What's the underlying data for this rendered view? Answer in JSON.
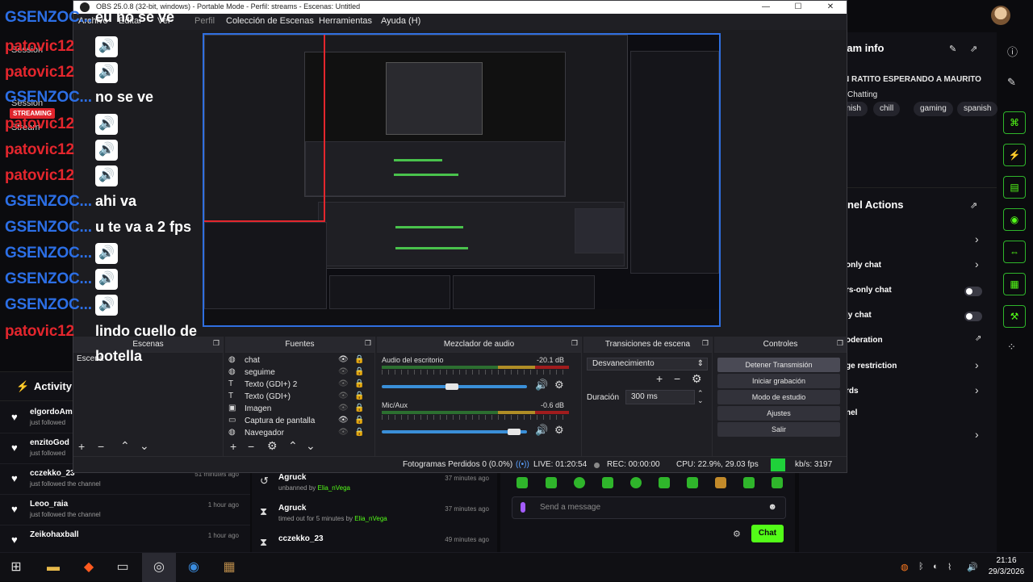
{
  "kick": {
    "left_nav": [
      {
        "label": "Session"
      },
      {
        "label": "Session"
      },
      {
        "label": "Stream"
      }
    ],
    "live_badge": "STREAMING",
    "logo": "KICK",
    "activity": {
      "title": "Activity",
      "items": [
        {
          "user": "elgordoAm",
          "sub": "just followed",
          "time": ""
        },
        {
          "user": "enzitoGod",
          "sub": "just followed",
          "time": ""
        },
        {
          "user": "cczekko_23",
          "sub": "just followed the channel",
          "time": "51 minutes ago"
        },
        {
          "user": "Leoo_raia",
          "sub": "just followed the channel",
          "time": "1 hour ago"
        },
        {
          "user": "Zeikohaxball",
          "sub": "",
          "time": "1 hour ago"
        }
      ]
    },
    "mod_log": [
      {
        "user": "Agruck",
        "sub_prefix": "unbanned by ",
        "actor": "Elia_nVega",
        "time": "37 minutes ago",
        "icon": "unban-icon"
      },
      {
        "user": "Agruck",
        "sub_prefix": "timed out for 5 minutes by ",
        "actor": "Elia_nVega",
        "time": "37 minutes ago",
        "icon": "hourglass-icon"
      },
      {
        "user": "cczekko_23",
        "sub_prefix": "",
        "actor": "",
        "time": "49 minutes ago",
        "icon": "hourglass-icon"
      }
    ],
    "chat": {
      "placeholder": "Send a message",
      "send_label": "Chat"
    },
    "stream_info": {
      "title": "eam info",
      "stream_title": "N RATITO ESPERANDO A MAURITO",
      "category": "Chatting",
      "tags": [
        "anish",
        "chill",
        "gaming",
        "spanish"
      ]
    },
    "channel_actions": {
      "title": "nnel Actions",
      "rows": [
        {
          "label": "",
          "control": "chevron"
        },
        {
          "label": "only chat",
          "control": "chevron"
        },
        {
          "label": "rs-only chat",
          "control": "toggle"
        },
        {
          "label": "ly chat",
          "control": "toggle"
        },
        {
          "label": "oderation",
          "control": "external"
        },
        {
          "label": "ge restriction",
          "control": "chevron"
        },
        {
          "label": "rds",
          "control": "chevron"
        },
        {
          "label": "nel",
          "control": ""
        },
        {
          "label": "",
          "control": "chevron"
        }
      ]
    }
  },
  "overlay_chat": [
    {
      "name": "GSENZOC...",
      "color": "blue",
      "msg": "eu no se ve",
      "speaker": false
    },
    {
      "name": "patovic12",
      "color": "red",
      "msg": "",
      "speaker": true
    },
    {
      "name": "patovic12",
      "color": "red",
      "msg": "",
      "speaker": true
    },
    {
      "name": "GSENZOC...",
      "color": "blue",
      "msg": "no se ve",
      "speaker": false
    },
    {
      "name": "patovic12",
      "color": "red",
      "msg": "",
      "speaker": true
    },
    {
      "name": "patovic12",
      "color": "red",
      "msg": "",
      "speaker": true
    },
    {
      "name": "patovic12",
      "color": "red",
      "msg": "",
      "speaker": true
    },
    {
      "name": "GSENZOC...",
      "color": "blue",
      "msg": "ahi va",
      "speaker": false
    },
    {
      "name": "GSENZOC...",
      "color": "blue",
      "msg": "u te va a 2 fps",
      "speaker": false
    },
    {
      "name": "GSENZOC...",
      "color": "blue",
      "msg": "",
      "speaker": true
    },
    {
      "name": "GSENZOC...",
      "color": "blue",
      "msg": "",
      "speaker": true
    },
    {
      "name": "GSENZOC...",
      "color": "blue",
      "msg": "",
      "speaker": true
    },
    {
      "name": "patovic12",
      "color": "red",
      "msg": "lindo cuello de",
      "speaker": false
    },
    {
      "name": "",
      "color": "red",
      "msg": "botella",
      "speaker": false
    }
  ],
  "obs": {
    "title": "OBS 25.0.8 (32-bit, windows) - Portable Mode - Perfil: streams - Escenas: Untitled",
    "window_buttons": {
      "minimize": "—",
      "maximize": "☐",
      "close": "✕"
    },
    "menu": [
      {
        "label": "Archivo",
        "dim": false
      },
      {
        "label": "Editar",
        "dim": false
      },
      {
        "label": "Ver",
        "dim": false
      },
      {
        "label": "Perfil",
        "dim": true
      },
      {
        "label": "Colección de Escenas",
        "dim": false
      },
      {
        "label": "Herramientas",
        "dim": false
      },
      {
        "label": "Ayuda (H)",
        "dim": false
      }
    ],
    "docks": {
      "scenes": {
        "title": "Escenas",
        "items": [
          "Escena"
        ]
      },
      "sources": {
        "title": "Fuentes",
        "items": [
          {
            "name": "chat",
            "icon": "browser-icon",
            "visible": true
          },
          {
            "name": "seguime",
            "icon": "browser-icon",
            "visible": false
          },
          {
            "name": "Texto (GDI+) 2",
            "icon": "text-icon",
            "visible": false
          },
          {
            "name": "Texto (GDI+)",
            "icon": "text-icon",
            "visible": false
          },
          {
            "name": "Imagen",
            "icon": "image-icon",
            "visible": false
          },
          {
            "name": "Captura de pantalla",
            "icon": "monitor-icon",
            "visible": true
          },
          {
            "name": "Navegador",
            "icon": "browser-icon",
            "visible": false
          }
        ]
      },
      "mixer": {
        "title": "Mezclador de audio",
        "channels": [
          {
            "name": "Audio del escritorio",
            "db": "-20.1 dB",
            "level": 0.38,
            "volume": 0.48
          },
          {
            "name": "Mic/Aux",
            "db": "-0.6 dB",
            "level": 0.7,
            "volume": 0.95
          }
        ]
      },
      "transitions": {
        "title": "Transiciones de escena",
        "selected": "Desvanecimiento",
        "duration_label": "Duración",
        "duration_value": "300 ms"
      },
      "controls": {
        "title": "Controles",
        "buttons": [
          "Detener Transmisión",
          "Iniciar grabación",
          "Modo de estudio",
          "Ajustes",
          "Salir"
        ]
      }
    },
    "status": {
      "dropped": "Fotogramas Perdidos 0 (0.0%)",
      "live": "LIVE: 01:20:54",
      "rec": "REC: 00:00:00",
      "cpu": "CPU: 22.9%, 29.03 fps",
      "kbps": "kb/s: 3197"
    }
  },
  "taskbar": {
    "clock_time": "21:16",
    "clock_date": "29/3/2026"
  },
  "colors": {
    "kick_green": "#53fc18",
    "name_red": "#e3262d",
    "name_blue": "#2c6fe6",
    "obs_bg": "#1f1f24"
  }
}
